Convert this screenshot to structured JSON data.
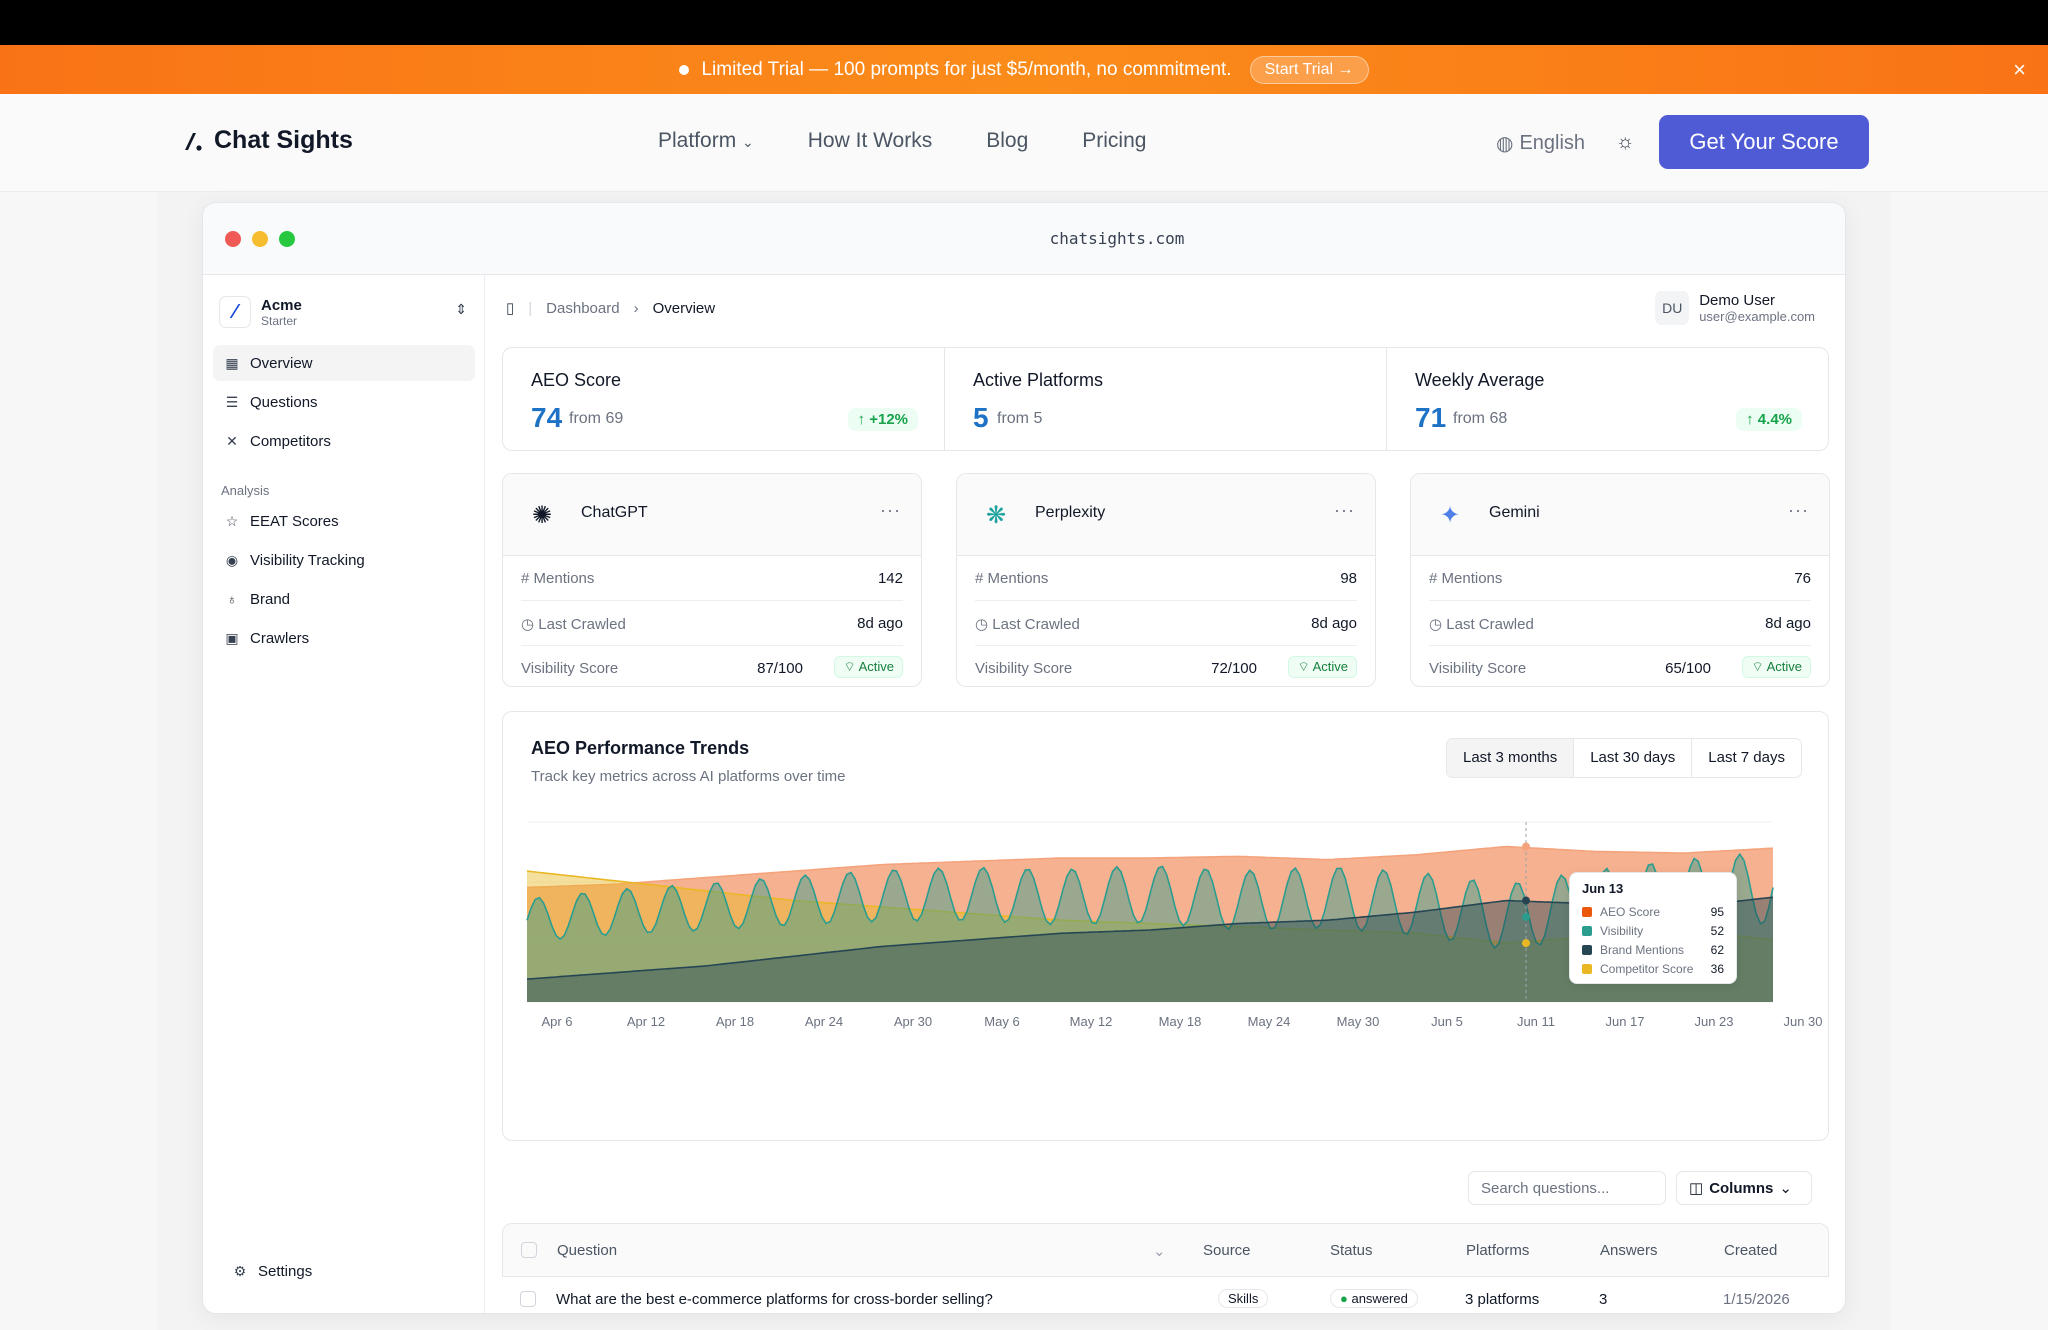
{
  "banner": {
    "text": "Limited Trial — 100 prompts for just $5/month, no commitment.",
    "cta": "Start Trial →",
    "close": "×"
  },
  "nav": {
    "brand": "Chat Sights",
    "links": [
      "Platform",
      "How It Works",
      "Blog",
      "Pricing"
    ],
    "language": "English",
    "cta": "Get Your Score"
  },
  "browser": {
    "url": "chatsights.com"
  },
  "sidebar": {
    "org_name": "Acme",
    "org_plan": "Starter",
    "items": [
      "Overview",
      "Questions",
      "Competitors"
    ],
    "group_label": "Analysis",
    "analysis_items": [
      "EEAT Scores",
      "Visibility Tracking",
      "Brand",
      "Crawlers"
    ],
    "settings": "Settings"
  },
  "breadcrumb": {
    "root": "Dashboard",
    "current": "Overview"
  },
  "user": {
    "initials": "DU",
    "name": "Demo User",
    "email": "user@example.com"
  },
  "stats": [
    {
      "label": "AEO Score",
      "value": "74",
      "from": "from 69",
      "delta": "↑ +12%"
    },
    {
      "label": "Active Platforms",
      "value": "5",
      "from": "from 5",
      "delta": ""
    },
    {
      "label": "Weekly Average",
      "value": "71",
      "from": "from 68",
      "delta": "↑ 4.4%"
    }
  ],
  "platforms": [
    {
      "name": "ChatGPT",
      "mentions": "142",
      "crawled": "8d ago",
      "score": "87/100",
      "status": "Active"
    },
    {
      "name": "Perplexity",
      "mentions": "98",
      "crawled": "8d ago",
      "score": "72/100",
      "status": "Active"
    },
    {
      "name": "Gemini",
      "mentions": "76",
      "crawled": "8d ago",
      "score": "65/100",
      "status": "Active"
    }
  ],
  "platform_labels": {
    "mentions": "# Mentions",
    "crawled": "Last Crawled",
    "score": "Visibility Score"
  },
  "chart": {
    "title": "AEO Performance Trends",
    "subtitle": "Track key metrics across AI platforms over time",
    "ranges": [
      "Last 3 months",
      "Last 30 days",
      "Last 7 days"
    ],
    "tooltip": {
      "date": "Jun 13",
      "rows": [
        {
          "name": "AEO Score",
          "value": "95",
          "color": "#ea580c"
        },
        {
          "name": "Visibility",
          "value": "52",
          "color": "#2a9d8f"
        },
        {
          "name": "Brand Mentions",
          "value": "62",
          "color": "#264653"
        },
        {
          "name": "Competitor Score",
          "value": "36",
          "color": "#e9b824"
        }
      ]
    }
  },
  "chart_data": {
    "type": "area",
    "x": [
      "Apr 6",
      "Apr 12",
      "Apr 18",
      "Apr 24",
      "Apr 30",
      "May 6",
      "May 12",
      "May 18",
      "May 24",
      "May 30",
      "Jun 5",
      "Jun 11",
      "Jun 17",
      "Jun 23",
      "Jun 30"
    ],
    "series": [
      {
        "name": "AEO Score",
        "color": "#f4a37c",
        "values": [
          70,
          72,
          76,
          80,
          84,
          86,
          88,
          88,
          89,
          87,
          90,
          95,
          92,
          91,
          94
        ]
      },
      {
        "name": "Visibility",
        "color": "#2a9d8f",
        "values": [
          50,
          55,
          58,
          62,
          65,
          66,
          64,
          66,
          62,
          64,
          60,
          52,
          60,
          66,
          70
        ]
      },
      {
        "name": "Brand Mentions",
        "color": "#264653",
        "values": [
          14,
          18,
          22,
          28,
          34,
          38,
          42,
          44,
          48,
          50,
          55,
          62,
          60,
          58,
          64
        ]
      },
      {
        "name": "Competitor Score",
        "color": "#e9b824",
        "values": [
          80,
          74,
          68,
          62,
          58,
          54,
          50,
          48,
          46,
          44,
          42,
          36,
          40,
          44,
          38
        ]
      }
    ],
    "ylim": [
      0,
      110
    ]
  },
  "table": {
    "search_placeholder": "Search questions...",
    "columns_btn": "Columns",
    "headers": [
      "Question",
      "Source",
      "Status",
      "Platforms",
      "Answers",
      "Created"
    ],
    "rows": [
      {
        "question": "What are the best e-commerce platforms for cross-border selling?",
        "source": "Skills",
        "status": "answered",
        "platforms": "3 platforms",
        "answers": "3",
        "created": "1/15/2026"
      }
    ]
  }
}
